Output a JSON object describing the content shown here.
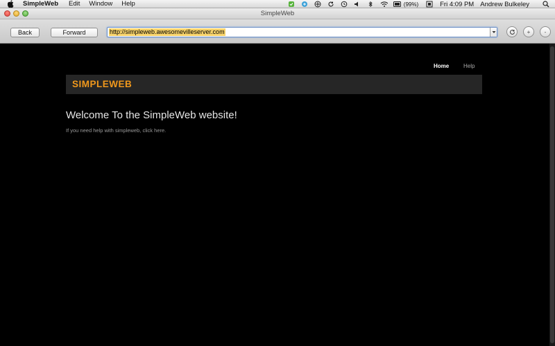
{
  "menubar": {
    "app_name": "SimpleWeb",
    "items": [
      "Edit",
      "Window",
      "Help"
    ],
    "battery": "(99%)",
    "clock": "Fri 4:09 PM",
    "user": "Andrew Bulkeley"
  },
  "window": {
    "title": "SimpleWeb"
  },
  "toolbar": {
    "back_label": "Back",
    "forward_label": "Forward",
    "url": "http://simpleweb.awesomevilleserver.com",
    "zoom_in_label": "+",
    "zoom_out_label": "-"
  },
  "page": {
    "nav": [
      "Home",
      "Help"
    ],
    "logo": "SIMPLEWEB",
    "heading": "Welcome To the SimpleWeb website!",
    "help_prefix": "If you need help with simpleweb, click ",
    "help_link": "here",
    "help_suffix": "."
  },
  "colors": {
    "logo": "#f0981c",
    "banner": "#262626",
    "background": "#000000",
    "url_highlight": "#f7d36b"
  }
}
